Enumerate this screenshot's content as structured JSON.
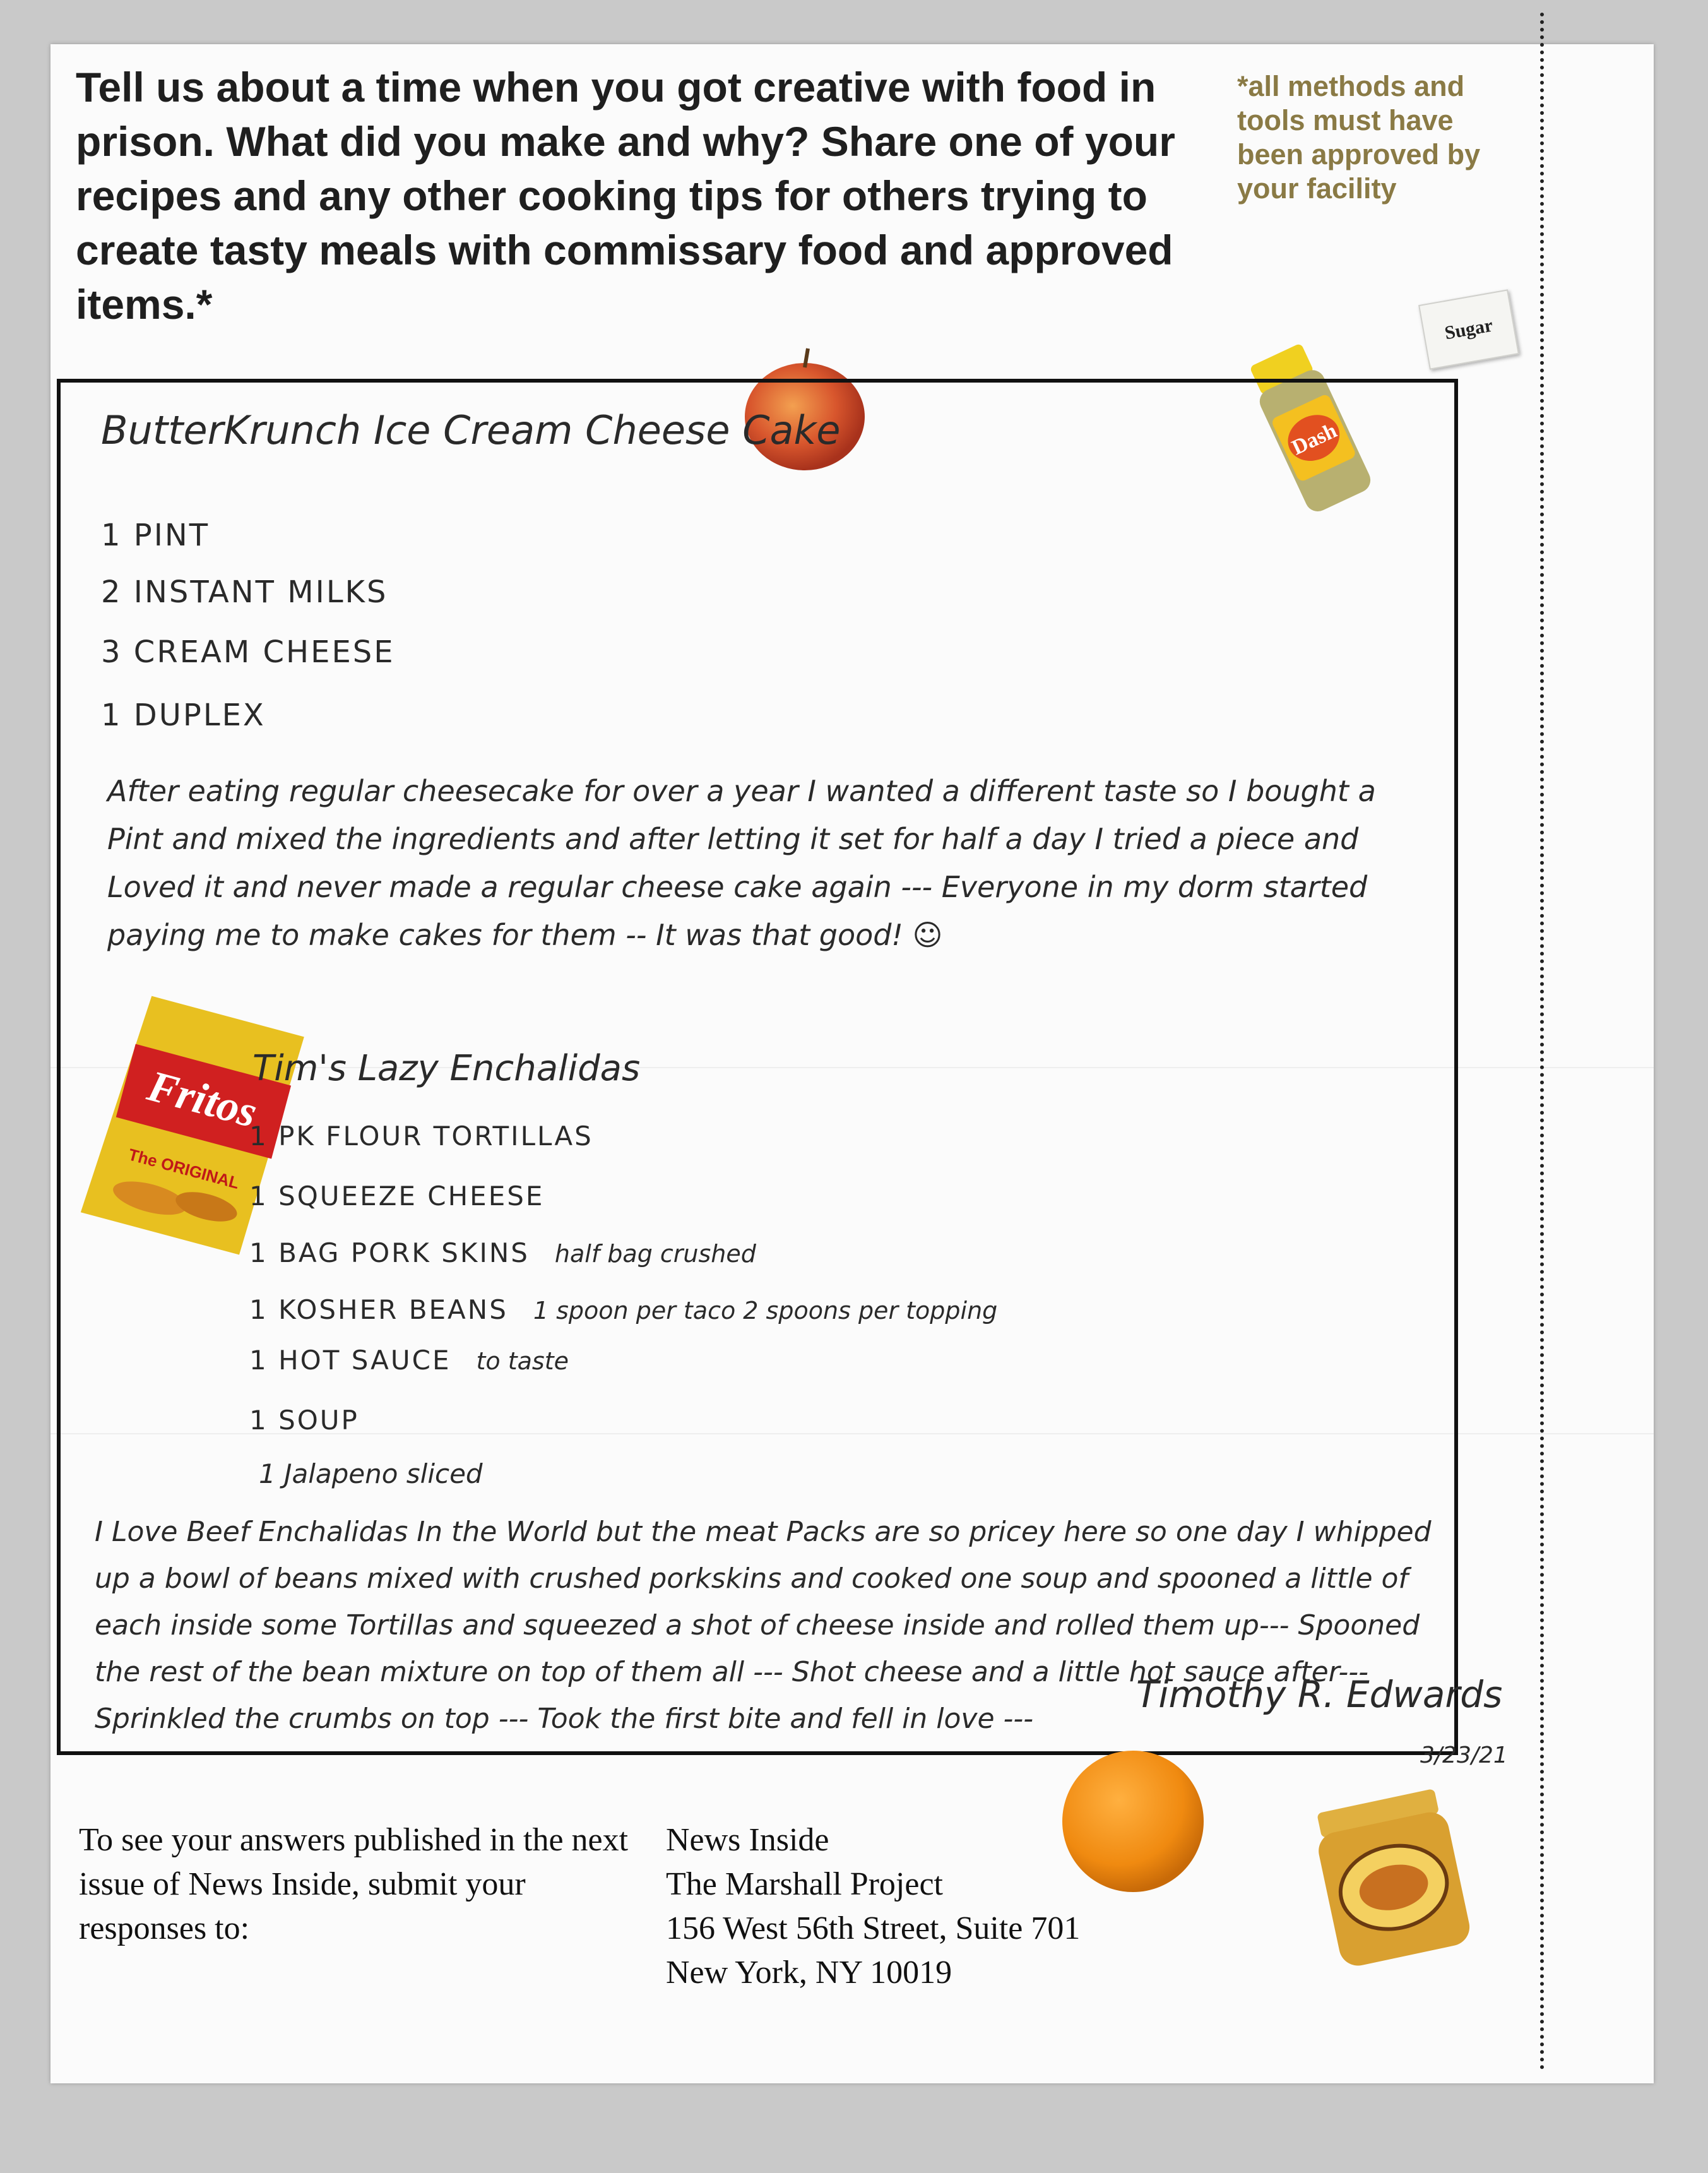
{
  "prompt": "Tell us about a time when you got creative with food in prison. What did you make and why? Share one of your recipes and any other cooking tips for others trying to create tasty meals with commissary food and approved items.*",
  "note": "*all methods and tools must have been approved by your facility",
  "stickers": {
    "sugar_label": "Sugar",
    "dash_label": "Dash",
    "fritos_label": "Fritos",
    "fritos_sub": "The ORIGINAL"
  },
  "recipe1": {
    "title": "ButterKrunch Ice Cream Cheese Cake",
    "ingredients": [
      "1 PINT",
      "2 INSTANT MILKS",
      "3 CREAM CHEESE",
      "1 DUPLEX"
    ],
    "story": "After eating regular cheesecake for over a year I wanted a different taste so I bought a Pint and mixed the ingredients and after letting it set for half a day I tried a piece and Loved it and never made a regular cheese cake again --- Everyone in my dorm started paying me to make cakes for them -- It was that good! ☺"
  },
  "recipe2": {
    "title": "Tim's Lazy Enchalidas",
    "ingredients": [
      {
        "item": "1 PK FLOUR TORTILLAS",
        "note": ""
      },
      {
        "item": "1 SQUEEZE CHEESE",
        "note": ""
      },
      {
        "item": "1 BAG PORK SKINS",
        "note": "half bag crushed"
      },
      {
        "item": "1 KOSHER BEANS",
        "note": "1 spoon per taco 2 spoons per topping"
      },
      {
        "item": "1 HOT SAUCE",
        "note": "to taste"
      },
      {
        "item": "1 SOUP",
        "note": ""
      },
      {
        "item": "1 Jalapeno sliced",
        "note": ""
      }
    ],
    "story": "I Love Beef Enchalidas In the World but the meat Packs are so pricey here so one day I whipped up a bowl of beans mixed with crushed porkskins and cooked one soup and spooned a little of each inside some Tortillas and squeezed a shot of cheese inside and rolled them up--- Spooned the rest of the bean mixture on top of them all --- Shot cheese and a little hot sauce after--- Sprinkled the crumbs on top --- Took the first bite and fell in love ---"
  },
  "signature": "Timothy R. Edwards",
  "date": "3/23/21",
  "footer": {
    "instructions": "To see your answers published in the next issue of News Inside, submit your responses to:",
    "address": [
      "News Inside",
      "The Marshall Project",
      "156 West 56th Street, Suite 701",
      "New York, NY 10019"
    ]
  }
}
